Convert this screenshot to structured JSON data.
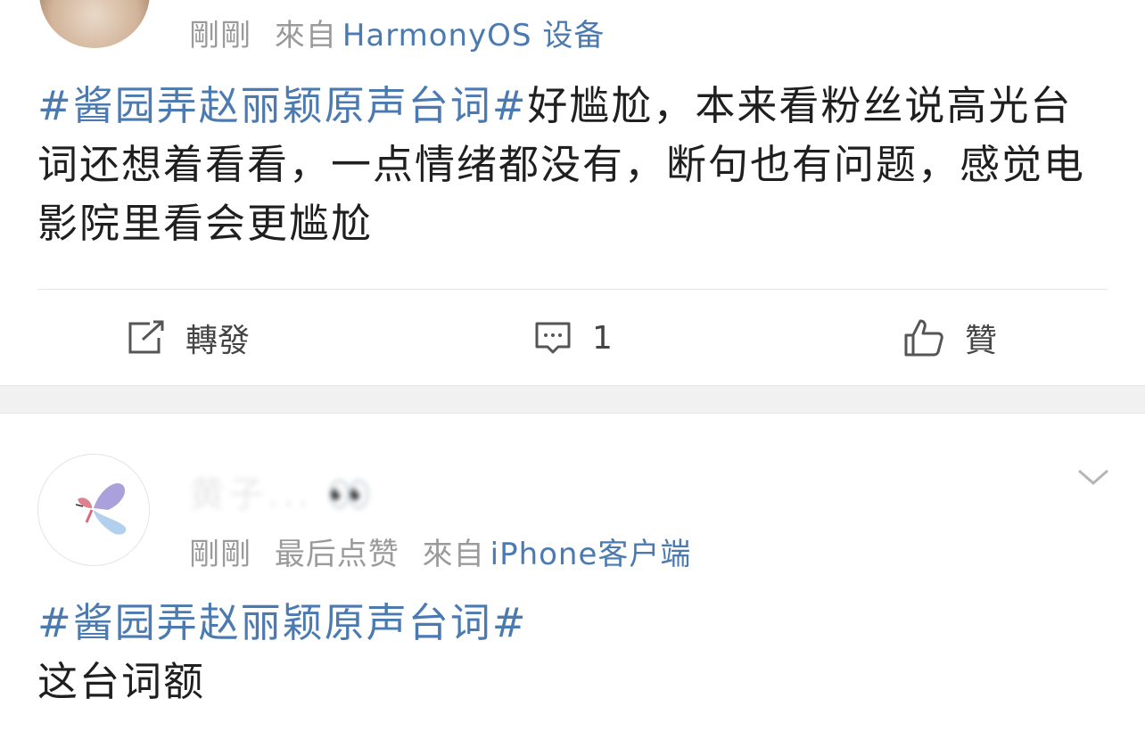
{
  "post1": {
    "time": "剛剛",
    "source_prefix": "來自",
    "source": "HarmonyOS 设备",
    "topic": "#酱园弄赵丽颖原声台词#",
    "text": "好尴尬，本来看粉丝说高光台词还想着看看，一点情绪都没有，断句也有问题，感觉电影院里看会更尴尬",
    "actions": {
      "repost_label": "轉發",
      "comment_count": "1",
      "like_label": "贊"
    }
  },
  "post2": {
    "username": "黄子... 👀",
    "time": "剛剛",
    "liked_note": "最后点赞",
    "source_prefix": "來自",
    "source": "iPhone客户端",
    "topic": "#酱园弄赵丽颖原声台词#",
    "text": "这台词额"
  },
  "colors": {
    "link": "#4b7ab1",
    "meta": "#9a9a9a",
    "separator": "#f1f1f1"
  }
}
